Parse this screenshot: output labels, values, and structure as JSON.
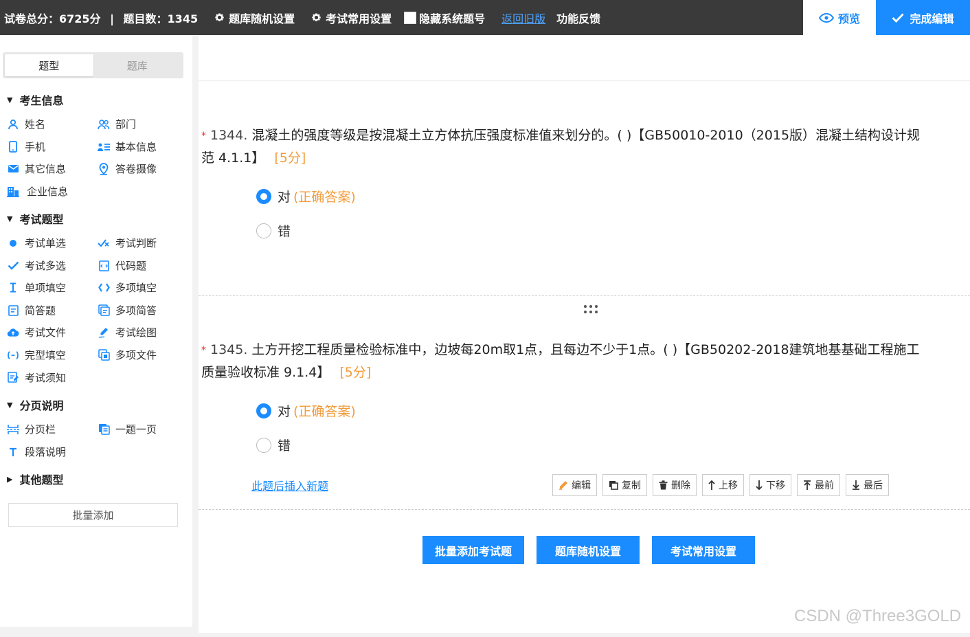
{
  "topbar": {
    "total_score_label": "试卷总分：6725分",
    "separator": "|",
    "question_count_label": "题目数：1345",
    "random_settings": "题库随机设置",
    "common_settings": "考试常用设置",
    "hide_system_numbers": "隐藏系统题号",
    "back_old_version": "返回旧版",
    "feedback": "功能反馈",
    "preview": "预览",
    "finish_edit": "完成编辑"
  },
  "sidebar": {
    "tabs": [
      "题型",
      "题库"
    ],
    "sections": [
      {
        "title": "考生信息",
        "items": [
          "姓名",
          "部门",
          "手机",
          "基本信息",
          "其它信息",
          "答卷摄像",
          "企业信息"
        ]
      },
      {
        "title": "考试题型",
        "items": [
          "考试单选",
          "考试判断",
          "考试多选",
          "代码题",
          "单项填空",
          "多项填空",
          "简答题",
          "多项简答",
          "考试文件",
          "考试绘图",
          "完型填空",
          "多项文件",
          "考试须知"
        ]
      },
      {
        "title": "分页说明",
        "items": [
          "分页栏",
          "一题一页",
          "段落说明"
        ]
      },
      {
        "title": "其他题型",
        "items": []
      }
    ],
    "batch_add": "批量添加"
  },
  "questions": [
    {
      "star": "*",
      "number": "1344.",
      "text": "混凝土的强度等级是按混凝土立方体抗压强度标准值来划分的。( )【GB50010-2010（2015版）混凝土结构设计规范 4.1.1】",
      "score": "[5分]",
      "options": [
        {
          "label": "对",
          "tag": "(正确答案)",
          "selected": true
        },
        {
          "label": "错",
          "tag": "",
          "selected": false
        }
      ]
    },
    {
      "star": "*",
      "number": "1345.",
      "text": "土方开挖工程质量检验标准中，边坡每20m取1点，且每边不少于1点。( )【GB50202-2018建筑地基基础工程施工质量验收标准 9.1.4】",
      "score": "[5分]",
      "options": [
        {
          "label": "对",
          "tag": "(正确答案)",
          "selected": true
        },
        {
          "label": "错",
          "tag": "",
          "selected": false
        }
      ]
    }
  ],
  "insert_after": "此题后插入新题",
  "toolbar": [
    "编辑",
    "复制",
    "删除",
    "上移",
    "下移",
    "最前",
    "最后"
  ],
  "bottom_buttons": [
    "批量添加考试题",
    "题库随机设置",
    "考试常用设置"
  ],
  "watermark": "CSDN @Three3GOLD",
  "colors": {
    "accent": "#1a8cff",
    "topbar_bg": "#3a3a3a",
    "score_orange": "#f29b38",
    "required_red": "#e0342a"
  }
}
